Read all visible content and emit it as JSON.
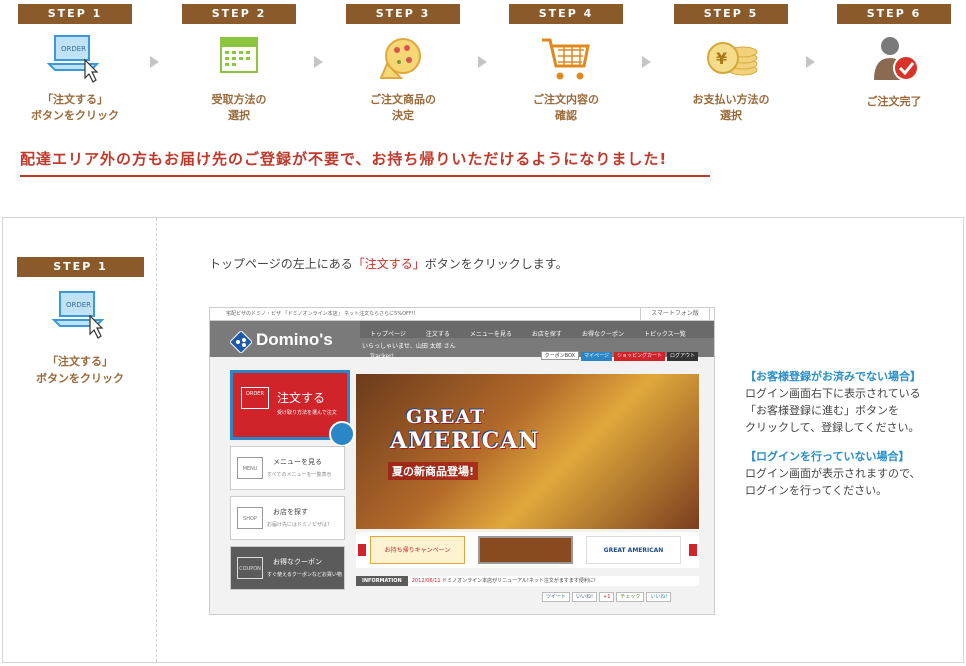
{
  "steps": [
    {
      "badge": "STEP 1",
      "label_line1": "「注文する」",
      "label_line2": "ボタンをクリック",
      "icon": "order-laptop-icon"
    },
    {
      "badge": "STEP 2",
      "label_line1": "受取方法の",
      "label_line2": "選択",
      "icon": "calendar-icon"
    },
    {
      "badge": "STEP 3",
      "label_line1": "ご注文商品の",
      "label_line2": "決定",
      "icon": "pizza-icon"
    },
    {
      "badge": "STEP 4",
      "label_line1": "ご注文内容の",
      "label_line2": "確認",
      "icon": "shopping-cart-icon"
    },
    {
      "badge": "STEP 5",
      "label_line1": "お支払い方法の",
      "label_line2": "選択",
      "icon": "yen-coins-icon"
    },
    {
      "badge": "STEP 6",
      "label_line1": "ご注文完了",
      "label_line2": "",
      "icon": "user-check-icon"
    }
  ],
  "headline": "配達エリア外の方もお届け先のご登録が不要で、お持ち帰りいただけるようになりました!",
  "detail": {
    "badge": "STEP 1",
    "label_line1": "「注文する」",
    "label_line2": "ボタンをクリック",
    "instruction_pre": "トップページの左上にある",
    "instruction_highlight": "「注文する」",
    "instruction_post": "ボタンをクリックします。"
  },
  "screenshot": {
    "top_text": "宅配ピザのドミノ・ピザ 「ドミノオンライン本店」 ネット注文ならさらに5%OFF!!",
    "smartphone_tab": "スマートフォン版",
    "logo": "Domino's",
    "nav": [
      "トップページ",
      "注文する",
      "メニューを見る",
      "お店を探す",
      "お得なクーポン",
      "トピックス一覧",
      "Tracker!"
    ],
    "welcome": "いらっしゃいませ、山田 太郎 さん",
    "mini_buttons": [
      "クーポンBOX",
      "マイページ",
      "ショッピングカート",
      "ログアウト"
    ],
    "order_title": "注文する",
    "order_sub": "受け取り方法を選んで注文",
    "order_icon_text": "ORDER",
    "menu_title": "メニューを見る",
    "menu_sub": "すべてのメニューを一覧表示",
    "menu_icon_text": "MENU",
    "shop_title": "お店を探す",
    "shop_sub": "お届け先にはドミノピザは?",
    "shop_icon_text": "SHOP",
    "coupon_title": "お得なクーポン",
    "coupon_sub": "すぐ使えるクーポンなどお買い物",
    "coupon_icon_text": "COUPON",
    "hero_line1": "GREAT",
    "hero_line2": "AMERICAN",
    "hero_sub": "夏の新商品登場!",
    "thumb1": "お持ち帰りキャンペーン",
    "thumb3": "GREAT AMERICAN",
    "info_label": "INFORMATION",
    "info_date": "2012/06/11",
    "info_text": "ドミノオンライン本店がリニューアル!ネット注文がますます便利に!",
    "social": [
      "ツイート",
      "いいね!",
      "+1",
      "チェック",
      "いいね!"
    ]
  },
  "notes": {
    "case1_title": "【お客様登録がお済みでない場合】",
    "case1_line1": "ログイン画面右下に表示されている",
    "case1_line2": "「お客様登録に進む」ボタンを",
    "case1_line3": "クリックして、登録してください。",
    "case2_title": "【ログインを行っていない場合】",
    "case2_line1": "ログイン画面が表示されますので、",
    "case2_line2": "ログインを行ってください。"
  },
  "colors": {
    "badge": "#8b5a2b",
    "label": "#9a6a3a",
    "headline": "#c0392b",
    "accent_blue": "#2a8fc9",
    "order_red": "#d0232a"
  }
}
